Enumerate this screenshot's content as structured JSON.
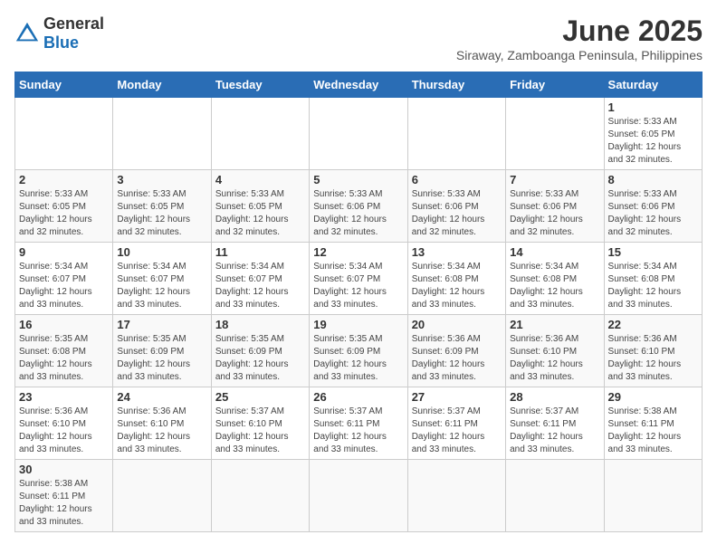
{
  "header": {
    "logo_general": "General",
    "logo_blue": "Blue",
    "month_title": "June 2025",
    "location": "Siraway, Zamboanga Peninsula, Philippines"
  },
  "calendar": {
    "days_of_week": [
      "Sunday",
      "Monday",
      "Tuesday",
      "Wednesday",
      "Thursday",
      "Friday",
      "Saturday"
    ],
    "weeks": [
      [
        {
          "day": "",
          "info": ""
        },
        {
          "day": "",
          "info": ""
        },
        {
          "day": "",
          "info": ""
        },
        {
          "day": "",
          "info": ""
        },
        {
          "day": "",
          "info": ""
        },
        {
          "day": "",
          "info": ""
        },
        {
          "day": "1",
          "info": "Sunrise: 5:33 AM\nSunset: 6:05 PM\nDaylight: 12 hours\nand 32 minutes."
        }
      ],
      [
        {
          "day": "2",
          "info": "Sunrise: 5:33 AM\nSunset: 6:05 PM\nDaylight: 12 hours\nand 32 minutes."
        },
        {
          "day": "3",
          "info": "Sunrise: 5:33 AM\nSunset: 6:05 PM\nDaylight: 12 hours\nand 32 minutes."
        },
        {
          "day": "4",
          "info": "Sunrise: 5:33 AM\nSunset: 6:05 PM\nDaylight: 12 hours\nand 32 minutes."
        },
        {
          "day": "5",
          "info": "Sunrise: 5:33 AM\nSunset: 6:06 PM\nDaylight: 12 hours\nand 32 minutes."
        },
        {
          "day": "6",
          "info": "Sunrise: 5:33 AM\nSunset: 6:06 PM\nDaylight: 12 hours\nand 32 minutes."
        },
        {
          "day": "7",
          "info": "Sunrise: 5:33 AM\nSunset: 6:06 PM\nDaylight: 12 hours\nand 32 minutes."
        },
        {
          "day": "8",
          "info": "Sunrise: 5:33 AM\nSunset: 6:06 PM\nDaylight: 12 hours\nand 32 minutes."
        }
      ],
      [
        {
          "day": "9",
          "info": "Sunrise: 5:34 AM\nSunset: 6:07 PM\nDaylight: 12 hours\nand 33 minutes."
        },
        {
          "day": "10",
          "info": "Sunrise: 5:34 AM\nSunset: 6:07 PM\nDaylight: 12 hours\nand 33 minutes."
        },
        {
          "day": "11",
          "info": "Sunrise: 5:34 AM\nSunset: 6:07 PM\nDaylight: 12 hours\nand 33 minutes."
        },
        {
          "day": "12",
          "info": "Sunrise: 5:34 AM\nSunset: 6:07 PM\nDaylight: 12 hours\nand 33 minutes."
        },
        {
          "day": "13",
          "info": "Sunrise: 5:34 AM\nSunset: 6:08 PM\nDaylight: 12 hours\nand 33 minutes."
        },
        {
          "day": "14",
          "info": "Sunrise: 5:34 AM\nSunset: 6:08 PM\nDaylight: 12 hours\nand 33 minutes."
        },
        {
          "day": "15",
          "info": "Sunrise: 5:34 AM\nSunset: 6:08 PM\nDaylight: 12 hours\nand 33 minutes."
        }
      ],
      [
        {
          "day": "16",
          "info": "Sunrise: 5:35 AM\nSunset: 6:08 PM\nDaylight: 12 hours\nand 33 minutes."
        },
        {
          "day": "17",
          "info": "Sunrise: 5:35 AM\nSunset: 6:09 PM\nDaylight: 12 hours\nand 33 minutes."
        },
        {
          "day": "18",
          "info": "Sunrise: 5:35 AM\nSunset: 6:09 PM\nDaylight: 12 hours\nand 33 minutes."
        },
        {
          "day": "19",
          "info": "Sunrise: 5:35 AM\nSunset: 6:09 PM\nDaylight: 12 hours\nand 33 minutes."
        },
        {
          "day": "20",
          "info": "Sunrise: 5:36 AM\nSunset: 6:09 PM\nDaylight: 12 hours\nand 33 minutes."
        },
        {
          "day": "21",
          "info": "Sunrise: 5:36 AM\nSunset: 6:10 PM\nDaylight: 12 hours\nand 33 minutes."
        },
        {
          "day": "22",
          "info": "Sunrise: 5:36 AM\nSunset: 6:10 PM\nDaylight: 12 hours\nand 33 minutes."
        }
      ],
      [
        {
          "day": "23",
          "info": "Sunrise: 5:36 AM\nSunset: 6:10 PM\nDaylight: 12 hours\nand 33 minutes."
        },
        {
          "day": "24",
          "info": "Sunrise: 5:36 AM\nSunset: 6:10 PM\nDaylight: 12 hours\nand 33 minutes."
        },
        {
          "day": "25",
          "info": "Sunrise: 5:37 AM\nSunset: 6:10 PM\nDaylight: 12 hours\nand 33 minutes."
        },
        {
          "day": "26",
          "info": "Sunrise: 5:37 AM\nSunset: 6:11 PM\nDaylight: 12 hours\nand 33 minutes."
        },
        {
          "day": "27",
          "info": "Sunrise: 5:37 AM\nSunset: 6:11 PM\nDaylight: 12 hours\nand 33 minutes."
        },
        {
          "day": "28",
          "info": "Sunrise: 5:37 AM\nSunset: 6:11 PM\nDaylight: 12 hours\nand 33 minutes."
        },
        {
          "day": "29",
          "info": "Sunrise: 5:38 AM\nSunset: 6:11 PM\nDaylight: 12 hours\nand 33 minutes."
        }
      ],
      [
        {
          "day": "30",
          "info": "Sunrise: 5:38 AM\nSunset: 6:11 PM\nDaylight: 12 hours\nand 33 minutes."
        },
        {
          "day": "",
          "info": ""
        },
        {
          "day": "",
          "info": ""
        },
        {
          "day": "",
          "info": ""
        },
        {
          "day": "",
          "info": ""
        },
        {
          "day": "",
          "info": ""
        },
        {
          "day": "",
          "info": ""
        }
      ]
    ]
  }
}
